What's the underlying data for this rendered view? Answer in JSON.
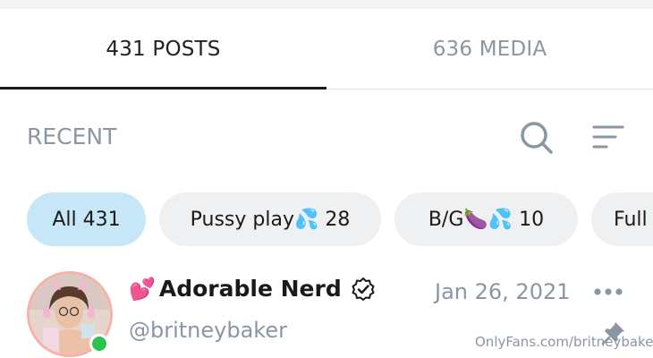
{
  "tabs": {
    "posts_label": "431 POSTS",
    "media_label": "636 MEDIA",
    "active": "posts"
  },
  "filter_bar": {
    "label": "RECENT",
    "search_icon": "search-icon",
    "sort_icon": "sort-icon"
  },
  "chips": [
    {
      "label": "All 431",
      "active": true
    },
    {
      "label": "Pussy play💦 28",
      "active": false
    },
    {
      "label": "B/G🍆💦 10",
      "active": false
    },
    {
      "label": "Full",
      "active": false
    }
  ],
  "post": {
    "author_prefix_emoji": "💕",
    "author_name": "Adorable Nerd",
    "handle": "@britneybaker",
    "date": "Jan 26, 2021",
    "verified": true,
    "online": true,
    "watermark": "OnlyFans.com/britneybaker"
  },
  "colors": {
    "accent_chip": "#c7e7f9",
    "muted_text": "#8a96a3",
    "online": "#2ac34f",
    "avatar_ring": "#f6b2a8"
  }
}
